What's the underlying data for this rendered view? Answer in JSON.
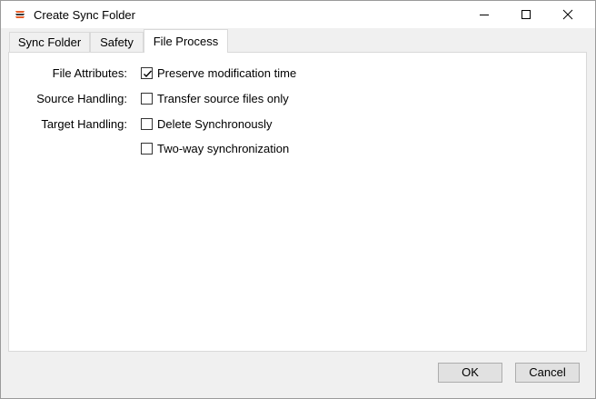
{
  "window": {
    "title": "Create Sync Folder",
    "icons": {
      "app": "app-logo-icon",
      "minimize": "minimize-icon",
      "maximize": "maximize-icon",
      "close": "close-icon"
    }
  },
  "tabs": [
    {
      "label": "Sync Folder",
      "active": false
    },
    {
      "label": "Safety",
      "active": false
    },
    {
      "label": "File Process",
      "active": true
    }
  ],
  "form": {
    "file_attributes": {
      "label": "File Attributes:",
      "option": "Preserve modification time",
      "checked": true
    },
    "source_handling": {
      "label": "Source Handling:",
      "option": "Transfer source files only",
      "checked": false
    },
    "target_handling": {
      "label": "Target Handling:",
      "option": "Delete Synchronously",
      "checked": false
    },
    "two_way": {
      "option": "Two-way synchronization",
      "checked": false
    }
  },
  "buttons": {
    "ok": "OK",
    "cancel": "Cancel"
  },
  "colors": {
    "app_icon": "#e8602c",
    "border": "#adadad",
    "panel_bg": "#ffffff",
    "dialog_bg": "#f0f0f0"
  }
}
